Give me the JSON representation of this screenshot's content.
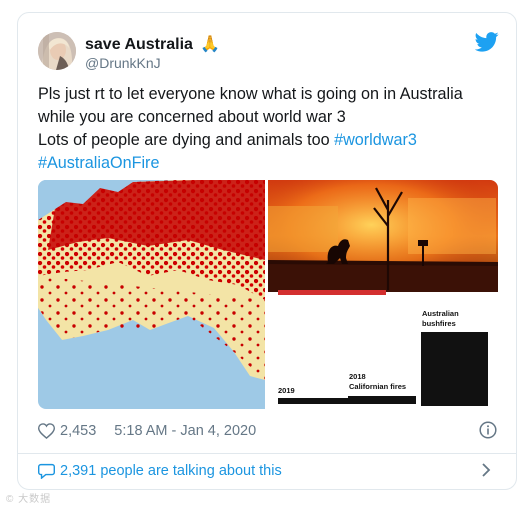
{
  "tweet": {
    "display_name": "save Australia",
    "name_emoji": "🙏",
    "handle": "@DrunkKnJ",
    "text_line1": "Pls just rt to let everyone know what is going on in Australia",
    "text_line2": "while you are concerned about world war 3",
    "text_line3": "Lots of people are dying and animals too ",
    "hashtag1": "#worldwar3",
    "hashtag2": "#AustraliaOnFire",
    "likes": "2,453",
    "time": "5:18 AM - Jan 4, 2020",
    "talking": "2,391 people are talking about this"
  },
  "media": {
    "chart_labels": {
      "aus": "Australian",
      "aus2": "bushfires",
      "cal_year": "2018",
      "cal": "Californian fires",
      "left_year": "2019"
    }
  },
  "watermark": "© 大数据"
}
